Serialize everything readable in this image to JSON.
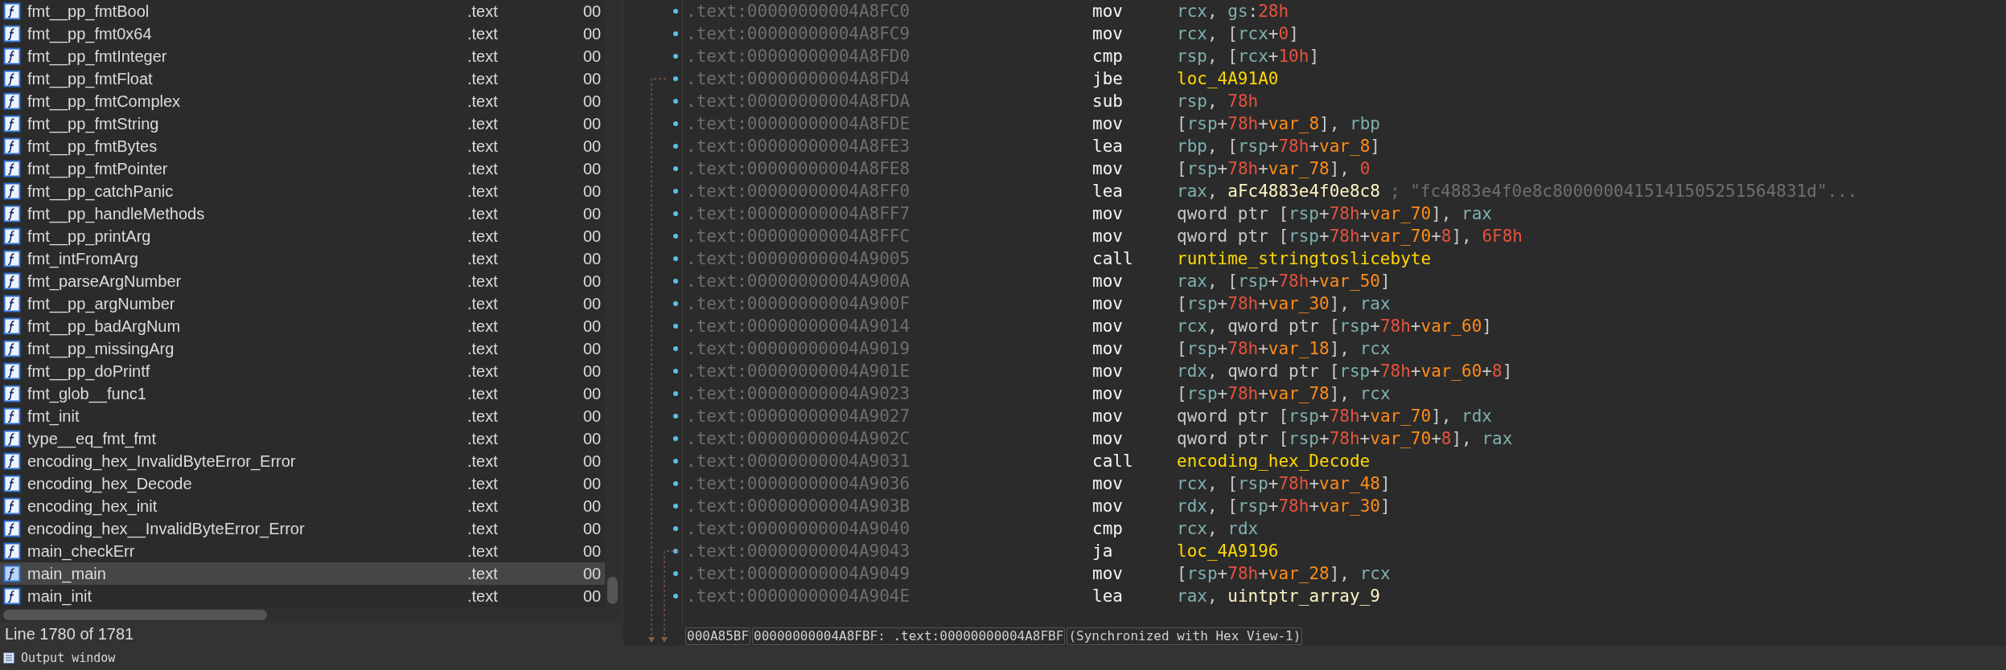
{
  "functions_window": {
    "rows": [
      {
        "name": "fmt__pp_fmtBool",
        "segment": ".text",
        "start": "00",
        "selected": false
      },
      {
        "name": "fmt__pp_fmt0x64",
        "segment": ".text",
        "start": "00",
        "selected": false
      },
      {
        "name": "fmt__pp_fmtInteger",
        "segment": ".text",
        "start": "00",
        "selected": false
      },
      {
        "name": "fmt__pp_fmtFloat",
        "segment": ".text",
        "start": "00",
        "selected": false
      },
      {
        "name": "fmt__pp_fmtComplex",
        "segment": ".text",
        "start": "00",
        "selected": false
      },
      {
        "name": "fmt__pp_fmtString",
        "segment": ".text",
        "start": "00",
        "selected": false
      },
      {
        "name": "fmt__pp_fmtBytes",
        "segment": ".text",
        "start": "00",
        "selected": false
      },
      {
        "name": "fmt__pp_fmtPointer",
        "segment": ".text",
        "start": "00",
        "selected": false
      },
      {
        "name": "fmt__pp_catchPanic",
        "segment": ".text",
        "start": "00",
        "selected": false
      },
      {
        "name": "fmt__pp_handleMethods",
        "segment": ".text",
        "start": "00",
        "selected": false
      },
      {
        "name": "fmt__pp_printArg",
        "segment": ".text",
        "start": "00",
        "selected": false
      },
      {
        "name": "fmt_intFromArg",
        "segment": ".text",
        "start": "00",
        "selected": false
      },
      {
        "name": "fmt_parseArgNumber",
        "segment": ".text",
        "start": "00",
        "selected": false
      },
      {
        "name": "fmt__pp_argNumber",
        "segment": ".text",
        "start": "00",
        "selected": false
      },
      {
        "name": "fmt__pp_badArgNum",
        "segment": ".text",
        "start": "00",
        "selected": false
      },
      {
        "name": "fmt__pp_missingArg",
        "segment": ".text",
        "start": "00",
        "selected": false
      },
      {
        "name": "fmt__pp_doPrintf",
        "segment": ".text",
        "start": "00",
        "selected": false
      },
      {
        "name": "fmt_glob__func1",
        "segment": ".text",
        "start": "00",
        "selected": false
      },
      {
        "name": "fmt_init",
        "segment": ".text",
        "start": "00",
        "selected": false
      },
      {
        "name": "type__eq_fmt_fmt",
        "segment": ".text",
        "start": "00",
        "selected": false
      },
      {
        "name": "encoding_hex_InvalidByteError_Error",
        "segment": ".text",
        "start": "00",
        "selected": false
      },
      {
        "name": "encoding_hex_Decode",
        "segment": ".text",
        "start": "00",
        "selected": false
      },
      {
        "name": "encoding_hex_init",
        "segment": ".text",
        "start": "00",
        "selected": false
      },
      {
        "name": "encoding_hex__InvalidByteError_Error",
        "segment": ".text",
        "start": "00",
        "selected": false
      },
      {
        "name": "main_checkErr",
        "segment": ".text",
        "start": "00",
        "selected": false
      },
      {
        "name": "main_main",
        "segment": ".text",
        "start": "00",
        "selected": true
      },
      {
        "name": "main_init",
        "segment": ".text",
        "start": "00",
        "selected": false
      }
    ],
    "status": "Line 1780 of 1781"
  },
  "disassembly": {
    "lines": [
      {
        "kind": "instruction",
        "address": ".text:00000000004A8FC0",
        "mnemonic": "mov",
        "operands": [
          {
            "kind": "reg",
            "text": "rcx"
          },
          {
            "kind": "text",
            "text": ", "
          },
          {
            "kind": "reg",
            "text": "gs"
          },
          {
            "kind": "text",
            "text": ":"
          },
          {
            "kind": "num",
            "text": "28h"
          }
        ]
      },
      {
        "kind": "instruction",
        "address": ".text:00000000004A8FC9",
        "mnemonic": "mov",
        "operands": [
          {
            "kind": "reg",
            "text": "rcx"
          },
          {
            "kind": "text",
            "text": ", ["
          },
          {
            "kind": "reg",
            "text": "rcx"
          },
          {
            "kind": "text",
            "text": "+"
          },
          {
            "kind": "num",
            "text": "0"
          },
          {
            "kind": "text",
            "text": "]"
          }
        ]
      },
      {
        "kind": "instruction",
        "address": ".text:00000000004A8FD0",
        "mnemonic": "cmp",
        "operands": [
          {
            "kind": "reg",
            "text": "rsp"
          },
          {
            "kind": "text",
            "text": ", ["
          },
          {
            "kind": "reg",
            "text": "rcx"
          },
          {
            "kind": "text",
            "text": "+"
          },
          {
            "kind": "num",
            "text": "10h"
          },
          {
            "kind": "text",
            "text": "]"
          }
        ]
      },
      {
        "kind": "jump",
        "address": ".text:00000000004A8FD4",
        "mnemonic": "jbe",
        "operands": [
          {
            "kind": "name",
            "text": "loc_4A91A0"
          }
        ]
      },
      {
        "kind": "instruction",
        "address": ".text:00000000004A8FDA",
        "mnemonic": "sub",
        "operands": [
          {
            "kind": "reg",
            "text": "rsp"
          },
          {
            "kind": "text",
            "text": ", "
          },
          {
            "kind": "num",
            "text": "78h"
          }
        ]
      },
      {
        "kind": "instruction",
        "address": ".text:00000000004A8FDE",
        "mnemonic": "mov",
        "operands": [
          {
            "kind": "text",
            "text": "["
          },
          {
            "kind": "reg",
            "text": "rsp"
          },
          {
            "kind": "text",
            "text": "+"
          },
          {
            "kind": "num",
            "text": "78h"
          },
          {
            "kind": "text",
            "text": "+"
          },
          {
            "kind": "var",
            "text": "var_8"
          },
          {
            "kind": "text",
            "text": "], "
          },
          {
            "kind": "reg",
            "text": "rbp"
          }
        ]
      },
      {
        "kind": "instruction",
        "address": ".text:00000000004A8FE3",
        "mnemonic": "lea",
        "operands": [
          {
            "kind": "reg",
            "text": "rbp"
          },
          {
            "kind": "text",
            "text": ", ["
          },
          {
            "kind": "reg",
            "text": "rsp"
          },
          {
            "kind": "text",
            "text": "+"
          },
          {
            "kind": "num",
            "text": "78h"
          },
          {
            "kind": "text",
            "text": "+"
          },
          {
            "kind": "var",
            "text": "var_8"
          },
          {
            "kind": "text",
            "text": "]"
          }
        ]
      },
      {
        "kind": "instruction",
        "address": ".text:00000000004A8FE8",
        "mnemonic": "mov",
        "operands": [
          {
            "kind": "text",
            "text": "["
          },
          {
            "kind": "reg",
            "text": "rsp"
          },
          {
            "kind": "text",
            "text": "+"
          },
          {
            "kind": "num",
            "text": "78h"
          },
          {
            "kind": "text",
            "text": "+"
          },
          {
            "kind": "var",
            "text": "var_78"
          },
          {
            "kind": "text",
            "text": "], "
          },
          {
            "kind": "num",
            "text": "0"
          }
        ]
      },
      {
        "kind": "instruction",
        "address": ".text:00000000004A8FF0",
        "mnemonic": "lea",
        "operands": [
          {
            "kind": "reg",
            "text": "rax"
          },
          {
            "kind": "text",
            "text": ", "
          },
          {
            "kind": "data",
            "text": "aFc4883e4f0e8c8"
          }
        ],
        "comment": "; \"fc4883e4f0e8c8000000415141505251564831d\"..."
      },
      {
        "kind": "instruction",
        "address": ".text:00000000004A8FF7",
        "mnemonic": "mov",
        "operands": [
          {
            "kind": "text",
            "text": "qword ptr ["
          },
          {
            "kind": "reg",
            "text": "rsp"
          },
          {
            "kind": "text",
            "text": "+"
          },
          {
            "kind": "num",
            "text": "78h"
          },
          {
            "kind": "text",
            "text": "+"
          },
          {
            "kind": "var",
            "text": "var_70"
          },
          {
            "kind": "text",
            "text": "], "
          },
          {
            "kind": "reg",
            "text": "rax"
          }
        ]
      },
      {
        "kind": "instruction",
        "address": ".text:00000000004A8FFC",
        "mnemonic": "mov",
        "operands": [
          {
            "kind": "text",
            "text": "qword ptr ["
          },
          {
            "kind": "reg",
            "text": "rsp"
          },
          {
            "kind": "text",
            "text": "+"
          },
          {
            "kind": "num",
            "text": "78h"
          },
          {
            "kind": "text",
            "text": "+"
          },
          {
            "kind": "var",
            "text": "var_70"
          },
          {
            "kind": "text",
            "text": "+"
          },
          {
            "kind": "num",
            "text": "8"
          },
          {
            "kind": "text",
            "text": "], "
          },
          {
            "kind": "num",
            "text": "6F8h"
          }
        ]
      },
      {
        "kind": "instruction",
        "address": ".text:00000000004A9005",
        "mnemonic": "call",
        "operands": [
          {
            "kind": "name",
            "text": "runtime_stringtoslicebyte"
          }
        ]
      },
      {
        "kind": "instruction",
        "address": ".text:00000000004A900A",
        "mnemonic": "mov",
        "operands": [
          {
            "kind": "reg",
            "text": "rax"
          },
          {
            "kind": "text",
            "text": ", ["
          },
          {
            "kind": "reg",
            "text": "rsp"
          },
          {
            "kind": "text",
            "text": "+"
          },
          {
            "kind": "num",
            "text": "78h"
          },
          {
            "kind": "text",
            "text": "+"
          },
          {
            "kind": "var",
            "text": "var_50"
          },
          {
            "kind": "text",
            "text": "]"
          }
        ]
      },
      {
        "kind": "instruction",
        "address": ".text:00000000004A900F",
        "mnemonic": "mov",
        "operands": [
          {
            "kind": "text",
            "text": "["
          },
          {
            "kind": "reg",
            "text": "rsp"
          },
          {
            "kind": "text",
            "text": "+"
          },
          {
            "kind": "num",
            "text": "78h"
          },
          {
            "kind": "text",
            "text": "+"
          },
          {
            "kind": "var",
            "text": "var_30"
          },
          {
            "kind": "text",
            "text": "], "
          },
          {
            "kind": "reg",
            "text": "rax"
          }
        ]
      },
      {
        "kind": "instruction",
        "address": ".text:00000000004A9014",
        "mnemonic": "mov",
        "operands": [
          {
            "kind": "reg",
            "text": "rcx"
          },
          {
            "kind": "text",
            "text": ", qword ptr ["
          },
          {
            "kind": "reg",
            "text": "rsp"
          },
          {
            "kind": "text",
            "text": "+"
          },
          {
            "kind": "num",
            "text": "78h"
          },
          {
            "kind": "text",
            "text": "+"
          },
          {
            "kind": "var",
            "text": "var_60"
          },
          {
            "kind": "text",
            "text": "]"
          }
        ]
      },
      {
        "kind": "instruction",
        "address": ".text:00000000004A9019",
        "mnemonic": "mov",
        "operands": [
          {
            "kind": "text",
            "text": "["
          },
          {
            "kind": "reg",
            "text": "rsp"
          },
          {
            "kind": "text",
            "text": "+"
          },
          {
            "kind": "num",
            "text": "78h"
          },
          {
            "kind": "text",
            "text": "+"
          },
          {
            "kind": "var",
            "text": "var_18"
          },
          {
            "kind": "text",
            "text": "], "
          },
          {
            "kind": "reg",
            "text": "rcx"
          }
        ]
      },
      {
        "kind": "instruction",
        "address": ".text:00000000004A901E",
        "mnemonic": "mov",
        "operands": [
          {
            "kind": "reg",
            "text": "rdx"
          },
          {
            "kind": "text",
            "text": ", qword ptr ["
          },
          {
            "kind": "reg",
            "text": "rsp"
          },
          {
            "kind": "text",
            "text": "+"
          },
          {
            "kind": "num",
            "text": "78h"
          },
          {
            "kind": "text",
            "text": "+"
          },
          {
            "kind": "var",
            "text": "var_60"
          },
          {
            "kind": "text",
            "text": "+"
          },
          {
            "kind": "num",
            "text": "8"
          },
          {
            "kind": "text",
            "text": "]"
          }
        ]
      },
      {
        "kind": "instruction",
        "address": ".text:00000000004A9023",
        "mnemonic": "mov",
        "operands": [
          {
            "kind": "text",
            "text": "["
          },
          {
            "kind": "reg",
            "text": "rsp"
          },
          {
            "kind": "text",
            "text": "+"
          },
          {
            "kind": "num",
            "text": "78h"
          },
          {
            "kind": "text",
            "text": "+"
          },
          {
            "kind": "var",
            "text": "var_78"
          },
          {
            "kind": "text",
            "text": "], "
          },
          {
            "kind": "reg",
            "text": "rcx"
          }
        ]
      },
      {
        "kind": "instruction",
        "address": ".text:00000000004A9027",
        "mnemonic": "mov",
        "operands": [
          {
            "kind": "text",
            "text": "qword ptr ["
          },
          {
            "kind": "reg",
            "text": "rsp"
          },
          {
            "kind": "text",
            "text": "+"
          },
          {
            "kind": "num",
            "text": "78h"
          },
          {
            "kind": "text",
            "text": "+"
          },
          {
            "kind": "var",
            "text": "var_70"
          },
          {
            "kind": "text",
            "text": "], "
          },
          {
            "kind": "reg",
            "text": "rdx"
          }
        ]
      },
      {
        "kind": "instruction",
        "address": ".text:00000000004A902C",
        "mnemonic": "mov",
        "operands": [
          {
            "kind": "text",
            "text": "qword ptr ["
          },
          {
            "kind": "reg",
            "text": "rsp"
          },
          {
            "kind": "text",
            "text": "+"
          },
          {
            "kind": "num",
            "text": "78h"
          },
          {
            "kind": "text",
            "text": "+"
          },
          {
            "kind": "var",
            "text": "var_70"
          },
          {
            "kind": "text",
            "text": "+"
          },
          {
            "kind": "num",
            "text": "8"
          },
          {
            "kind": "text",
            "text": "], "
          },
          {
            "kind": "reg",
            "text": "rax"
          }
        ]
      },
      {
        "kind": "instruction",
        "address": ".text:00000000004A9031",
        "mnemonic": "call",
        "operands": [
          {
            "kind": "name",
            "text": "encoding_hex_Decode"
          }
        ]
      },
      {
        "kind": "instruction",
        "address": ".text:00000000004A9036",
        "mnemonic": "mov",
        "operands": [
          {
            "kind": "reg",
            "text": "rcx"
          },
          {
            "kind": "text",
            "text": ", ["
          },
          {
            "kind": "reg",
            "text": "rsp"
          },
          {
            "kind": "text",
            "text": "+"
          },
          {
            "kind": "num",
            "text": "78h"
          },
          {
            "kind": "text",
            "text": "+"
          },
          {
            "kind": "var",
            "text": "var_48"
          },
          {
            "kind": "text",
            "text": "]"
          }
        ]
      },
      {
        "kind": "instruction",
        "address": ".text:00000000004A903B",
        "mnemonic": "mov",
        "operands": [
          {
            "kind": "reg",
            "text": "rdx"
          },
          {
            "kind": "text",
            "text": ", ["
          },
          {
            "kind": "reg",
            "text": "rsp"
          },
          {
            "kind": "text",
            "text": "+"
          },
          {
            "kind": "num",
            "text": "78h"
          },
          {
            "kind": "text",
            "text": "+"
          },
          {
            "kind": "var",
            "text": "var_30"
          },
          {
            "kind": "text",
            "text": "]"
          }
        ]
      },
      {
        "kind": "instruction",
        "address": ".text:00000000004A9040",
        "mnemonic": "cmp",
        "operands": [
          {
            "kind": "reg",
            "text": "rcx"
          },
          {
            "kind": "text",
            "text": ", "
          },
          {
            "kind": "reg",
            "text": "rdx"
          }
        ]
      },
      {
        "kind": "jump",
        "address": ".text:00000000004A9043",
        "mnemonic": "ja",
        "operands": [
          {
            "kind": "name",
            "text": "loc_4A9196"
          }
        ]
      },
      {
        "kind": "instruction",
        "address": ".text:00000000004A9049",
        "mnemonic": "mov",
        "operands": [
          {
            "kind": "text",
            "text": "["
          },
          {
            "kind": "reg",
            "text": "rsp"
          },
          {
            "kind": "text",
            "text": "+"
          },
          {
            "kind": "num",
            "text": "78h"
          },
          {
            "kind": "text",
            "text": "+"
          },
          {
            "kind": "var",
            "text": "var_28"
          },
          {
            "kind": "text",
            "text": "], "
          },
          {
            "kind": "reg",
            "text": "rcx"
          }
        ]
      },
      {
        "kind": "instruction",
        "address": ".text:00000000004A904E",
        "mnemonic": "lea",
        "operands": [
          {
            "kind": "reg",
            "text": "rax"
          },
          {
            "kind": "text",
            "text": ", "
          },
          {
            "kind": "data",
            "text": "uintptr_array_9"
          }
        ]
      }
    ],
    "status_bar": [
      "000A85BF",
      "00000000004A8FBF: .text:00000000004A8FBF",
      "(Synchronized with Hex View-1)"
    ]
  },
  "output_window": {
    "title": "Output window"
  }
}
